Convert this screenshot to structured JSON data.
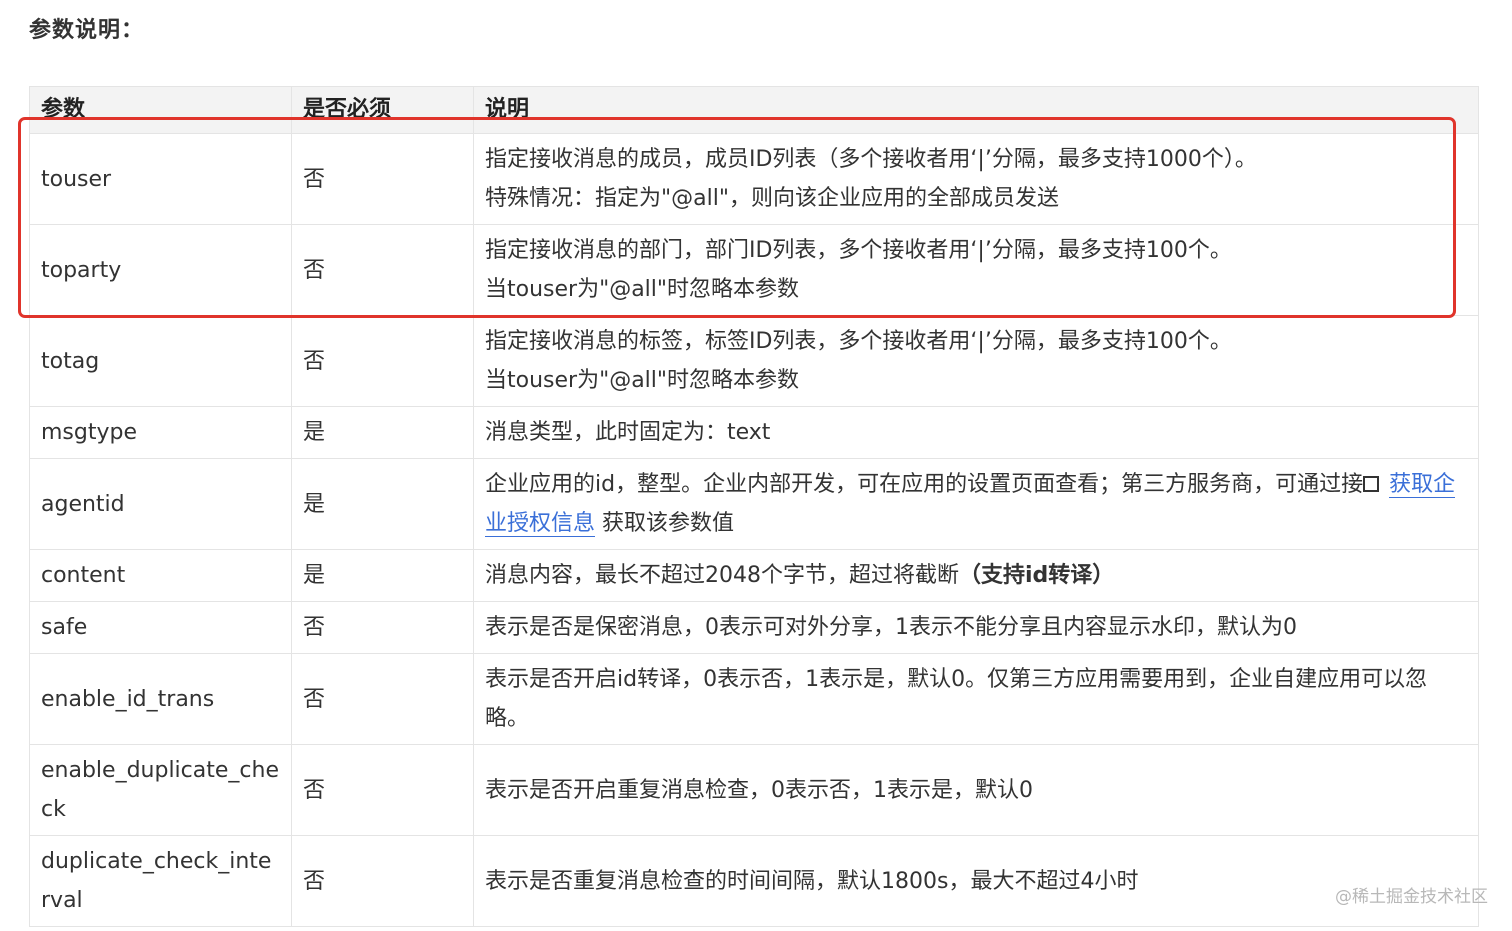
{
  "section_title": "参数说明：",
  "table": {
    "headers": [
      "参数",
      "是否必须",
      "说明"
    ],
    "rows": [
      {
        "param": "touser",
        "required": "否",
        "desc_1": "指定接收消息的成员，成员ID列表（多个接收者用‘|’分隔，最多支持1000个）。",
        "desc_2": "特殊情况：指定为\"@all\"，则向该企业应用的全部成员发送"
      },
      {
        "param": "toparty",
        "required": "否",
        "desc_1": "指定接收消息的部门，部门ID列表，多个接收者用‘|’分隔，最多支持100个。",
        "desc_2": "当touser为\"@all\"时忽略本参数"
      },
      {
        "param": "totag",
        "required": "否",
        "desc_1": "指定接收消息的标签，标签ID列表，多个接收者用‘|’分隔，最多支持100个。",
        "desc_2": "当touser为\"@all\"时忽略本参数"
      },
      {
        "param": "msgtype",
        "required": "是",
        "desc": "消息类型，此时固定为：text"
      },
      {
        "param": "agentid",
        "required": "是",
        "desc_before": "企业应用的id，整型。企业内部开发，可在应用的设置页面查看；第三方服务商，可通过接",
        "link": "获取企业授权信息",
        "desc_after": "获取该参数值"
      },
      {
        "param": "content",
        "required": "是",
        "desc": "消息内容，最长不超过2048个字节，超过将截断",
        "desc_bold": "（支持id转译）"
      },
      {
        "param": "safe",
        "required": "否",
        "desc": "表示是否是保密消息，0表示可对外分享，1表示不能分享且内容显示水印，默认为0"
      },
      {
        "param": "enable_id_trans",
        "required": "否",
        "desc": "表示是否开启id转译，0表示否，1表示是，默认0。仅第三方应用需要用到，企业自建应用可以忽略。"
      },
      {
        "param": "enable_duplicate_check",
        "required": "否",
        "desc": "表示是否开启重复消息检查，0表示否，1表示是，默认0"
      },
      {
        "param": "duplicate_check_interval",
        "required": "否",
        "desc": "表示是否重复消息检查的时间间隔，默认1800s，最大不超过4小时"
      }
    ]
  },
  "icons": {
    "link_icon": "external-link-icon"
  },
  "colors": {
    "highlight": "#e0342b",
    "link": "#3a6fd8",
    "header_bg": "#f3f3f3"
  },
  "watermark": "@稀土掘金技术社区"
}
